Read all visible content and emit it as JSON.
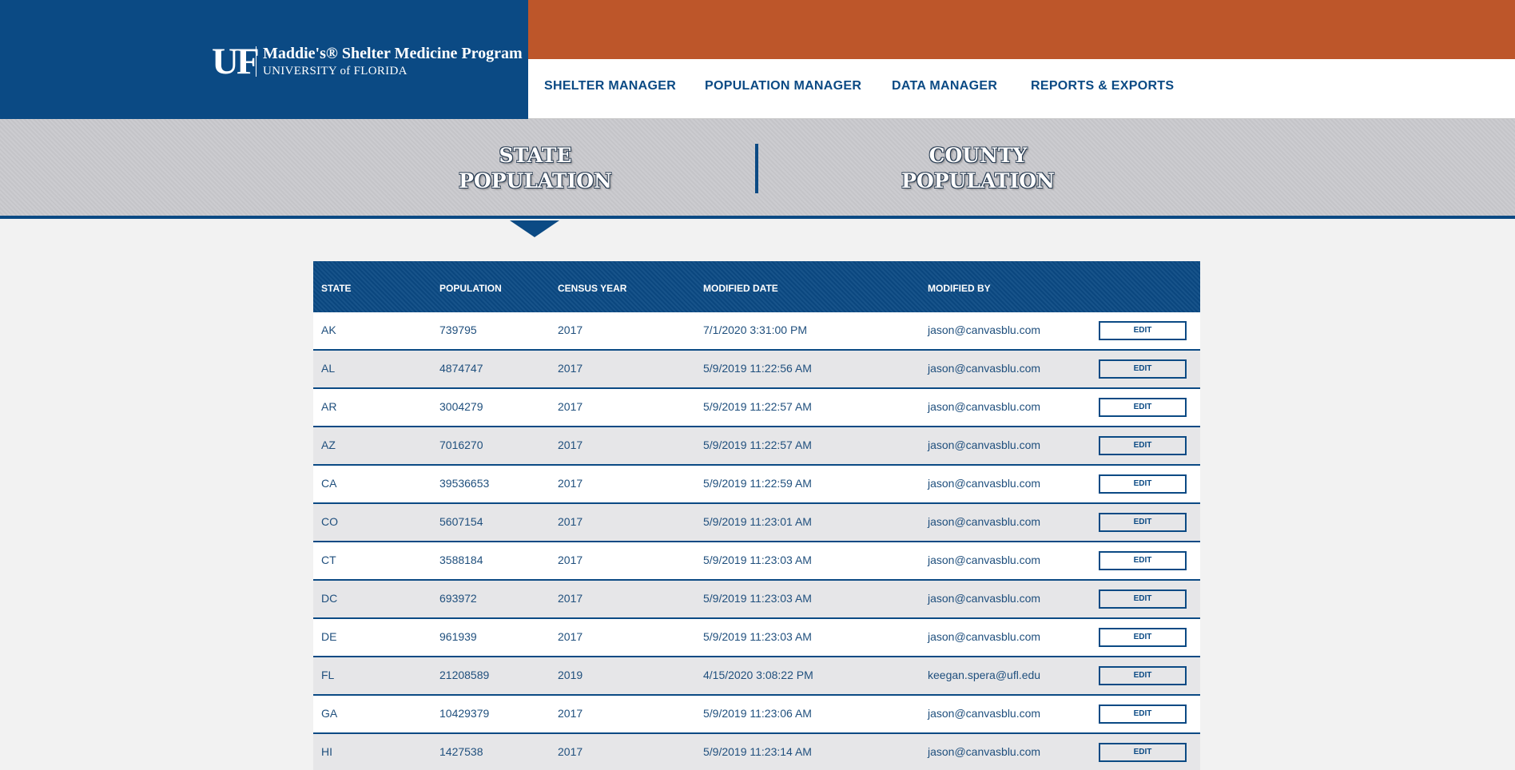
{
  "header": {
    "logo_mark": "UF",
    "program_name": "Maddie's® Shelter Medicine Program",
    "university_line": "UNIVERSITY of FLORIDA",
    "nav": [
      {
        "label": "SHELTER MANAGER"
      },
      {
        "label": "POPULATION MANAGER"
      },
      {
        "label": "DATA MANAGER"
      },
      {
        "label": "REPORTS & EXPORTS"
      }
    ]
  },
  "tabs": [
    {
      "line1": "STATE",
      "line2": "POPULATION",
      "active": true
    },
    {
      "line1": "COUNTY",
      "line2": "POPULATION",
      "active": false
    }
  ],
  "table": {
    "columns": [
      "STATE",
      "POPULATION",
      "CENSUS YEAR",
      "MODIFIED DATE",
      "MODIFIED BY"
    ],
    "edit_label": "EDIT",
    "rows": [
      {
        "state": "AK",
        "population": "739795",
        "year": "2017",
        "modified_date": "7/1/2020 3:31:00 PM",
        "modified_by": "jason@canvasblu.com"
      },
      {
        "state": "AL",
        "population": "4874747",
        "year": "2017",
        "modified_date": "5/9/2019 11:22:56 AM",
        "modified_by": "jason@canvasblu.com"
      },
      {
        "state": "AR",
        "population": "3004279",
        "year": "2017",
        "modified_date": "5/9/2019 11:22:57 AM",
        "modified_by": "jason@canvasblu.com"
      },
      {
        "state": "AZ",
        "population": "7016270",
        "year": "2017",
        "modified_date": "5/9/2019 11:22:57 AM",
        "modified_by": "jason@canvasblu.com"
      },
      {
        "state": "CA",
        "population": "39536653",
        "year": "2017",
        "modified_date": "5/9/2019 11:22:59 AM",
        "modified_by": "jason@canvasblu.com"
      },
      {
        "state": "CO",
        "population": "5607154",
        "year": "2017",
        "modified_date": "5/9/2019 11:23:01 AM",
        "modified_by": "jason@canvasblu.com"
      },
      {
        "state": "CT",
        "population": "3588184",
        "year": "2017",
        "modified_date": "5/9/2019 11:23:03 AM",
        "modified_by": "jason@canvasblu.com"
      },
      {
        "state": "DC",
        "population": "693972",
        "year": "2017",
        "modified_date": "5/9/2019 11:23:03 AM",
        "modified_by": "jason@canvasblu.com"
      },
      {
        "state": "DE",
        "population": "961939",
        "year": "2017",
        "modified_date": "5/9/2019 11:23:03 AM",
        "modified_by": "jason@canvasblu.com"
      },
      {
        "state": "FL",
        "population": "21208589",
        "year": "2019",
        "modified_date": "4/15/2020 3:08:22 PM",
        "modified_by": "keegan.spera@ufl.edu"
      },
      {
        "state": "GA",
        "population": "10429379",
        "year": "2017",
        "modified_date": "5/9/2019 11:23:06 AM",
        "modified_by": "jason@canvasblu.com"
      },
      {
        "state": "HI",
        "population": "1427538",
        "year": "2017",
        "modified_date": "5/9/2019 11:23:14 AM",
        "modified_by": "jason@canvasblu.com"
      }
    ]
  },
  "colors": {
    "primary_blue": "#0b4a84",
    "accent_orange": "#bd562a",
    "band_gray": "#c8c8cc"
  }
}
